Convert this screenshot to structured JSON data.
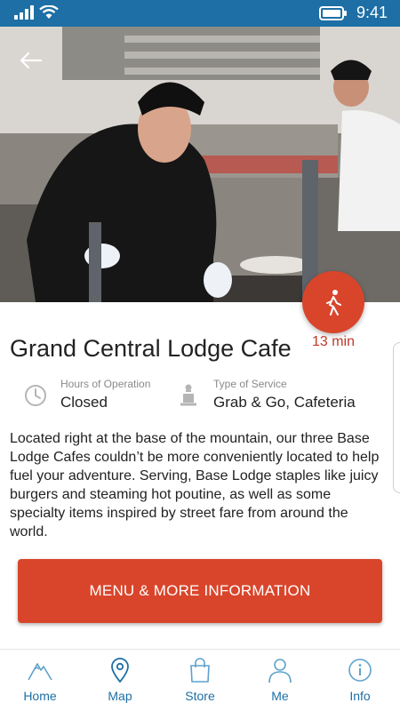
{
  "status_bar": {
    "time": "9:41"
  },
  "venue": {
    "name": "Grand Central Lodge Cafe",
    "walk_time": "13 min",
    "hours_label": "Hours of Operation",
    "hours_value": "Closed",
    "service_label": "Type of Service",
    "service_value": "Grab & Go, Cafeteria",
    "description": "Located right at the base of the mountain, our three Base Lodge Cafes couldn’t be more conveniently located to help fuel your adventure. Serving, Base Lodge staples like juicy burgers and steaming hot poutine, as well as some specialty items inspired by street fare from around the world."
  },
  "menu_button_label": "MENU & MORE INFORMATION",
  "nav": [
    {
      "label": "Home",
      "icon": "mountain-icon"
    },
    {
      "label": "Map",
      "icon": "map-pin-icon"
    },
    {
      "label": "Store",
      "icon": "shopping-bag-icon"
    },
    {
      "label": "Me",
      "icon": "person-icon"
    },
    {
      "label": "Info",
      "icon": "info-icon"
    }
  ],
  "colors": {
    "status_bar": "#1d6fa5",
    "accent": "#d9452b",
    "nav_blue": "#1d6fa5"
  }
}
